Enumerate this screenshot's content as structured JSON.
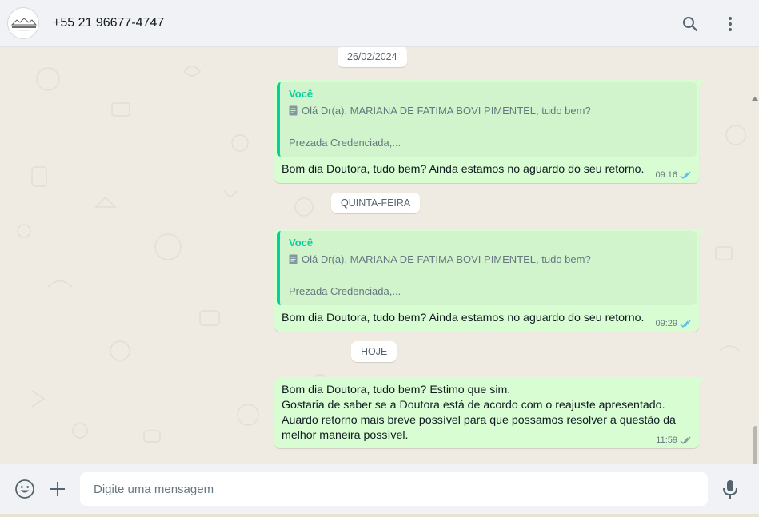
{
  "header": {
    "avatar_icon": "company-logo-avatar",
    "contact_name": "+55 21 96677-4747",
    "search_icon": "search-icon",
    "menu_icon": "vertical-dots-menu-icon"
  },
  "chat": {
    "date_chips": [
      "26/02/2024",
      "QUINTA-FEIRA",
      "HOJE"
    ],
    "messages": [
      {
        "quote_author": "Você",
        "quote_line1": "Olá Dr(a). MARIANA DE FATIMA BOVI PIMENTEL, tudo bem?",
        "quote_line2": "Prezada Credenciada,...",
        "text": "Bom dia Doutora, tudo bem? Ainda estamos no aguardo do seu retorno.",
        "time": "09:16",
        "status": "read"
      },
      {
        "quote_author": "Você",
        "quote_line1": "Olá Dr(a). MARIANA DE FATIMA BOVI PIMENTEL, tudo bem?",
        "quote_line2": "Prezada Credenciada,...",
        "text": "Bom dia Doutora, tudo bem? Ainda estamos no aguardo do seu retorno.",
        "time": "09:29",
        "status": "read"
      },
      {
        "text": "Bom dia Doutora, tudo bem? Estimo que sim.\nGostaria de saber se a Doutora está de acordo com o reajuste apresentado.\nAuardo retorno mais breve possível para que possamos resolver a questão da\nmelhor maneira possível.",
        "time": "11:59",
        "status": "delivered"
      }
    ]
  },
  "footer": {
    "emoji_icon": "emoji-icon",
    "attach_icon": "plus-attach-icon",
    "input_placeholder": "Digite uma mensagem",
    "mic_icon": "microphone-icon"
  },
  "colors": {
    "bubble_out": "#d9fdd3",
    "quote_accent": "#06cf9c",
    "read_tick": "#53bdeb",
    "chat_bg": "#efeae2"
  }
}
